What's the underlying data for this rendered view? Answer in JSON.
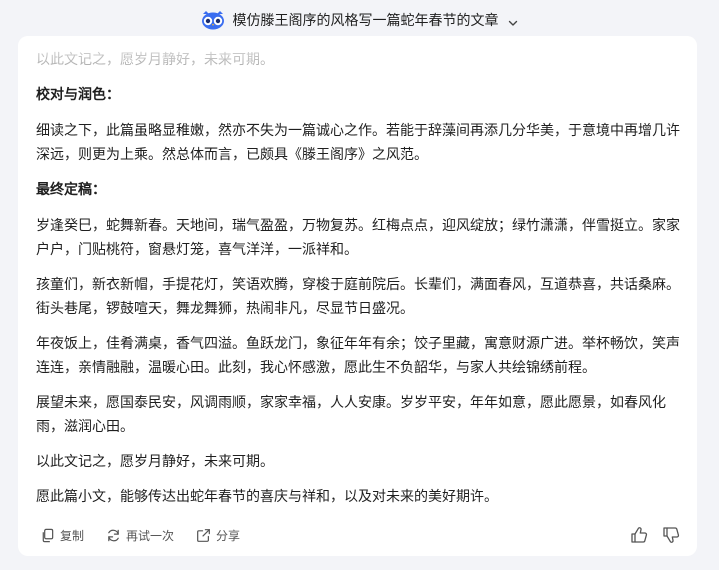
{
  "header": {
    "title": "模仿滕王阁序的风格写一篇蛇年春节的文章",
    "icon": "owl-logo-icon",
    "chevron_icon": "chevron-down-icon"
  },
  "article": {
    "faded_line": "以此文记之，愿岁月静好，未来可期。",
    "proofread_heading": "校对与润色：",
    "proofread_text": "细读之下，此篇虽略显稚嫩，然亦不失为一篇诚心之作。若能于辞藻间再添几分华美，于意境中再增几许深远，则更为上乘。然总体而言，已颇具《滕王阁序》之风范。",
    "final_heading": "最终定稿：",
    "paragraphs": [
      "岁逢癸巳，蛇舞新春。天地间，瑞气盈盈，万物复苏。红梅点点，迎风绽放；绿竹潇潇，伴雪挺立。家家户户，门贴桃符，窗悬灯笼，喜气洋洋，一派祥和。",
      "孩童们，新衣新帽，手提花灯，笑语欢腾，穿梭于庭前院后。长辈们，满面春风，互道恭喜，共话桑麻。街头巷尾，锣鼓喧天，舞龙舞狮，热闹非凡，尽显节日盛况。",
      "年夜饭上，佳肴满桌，香气四溢。鱼跃龙门，象征年年有余；饺子里藏，寓意财源广进。举杯畅饮，笑声连连，亲情融融，温暖心田。此刻，我心怀感激，愿此生不负韶华，与家人共绘锦绣前程。",
      "展望未来，愿国泰民安，风调雨顺，家家幸福，人人安康。岁岁平安，年年如意，愿此愿景，如春风化雨，滋润心田。",
      "以此文记之，愿岁月静好，未来可期。",
      "愿此篇小文，能够传达出蛇年春节的喜庆与祥和，以及对未来的美好期许。"
    ]
  },
  "actions": {
    "copy_label": "复制",
    "retry_label": "再试一次",
    "share_label": "分享",
    "copy_icon": "copy-icon",
    "retry_icon": "refresh-icon",
    "share_icon": "share-icon",
    "like_icon": "thumbs-up-icon",
    "dislike_icon": "thumbs-down-icon"
  },
  "colors": {
    "background": "#f3f4f8",
    "card": "#ffffff",
    "text": "#1f1f1f",
    "muted": "#9a9a9a",
    "logo_blue": "#3a6df0"
  }
}
